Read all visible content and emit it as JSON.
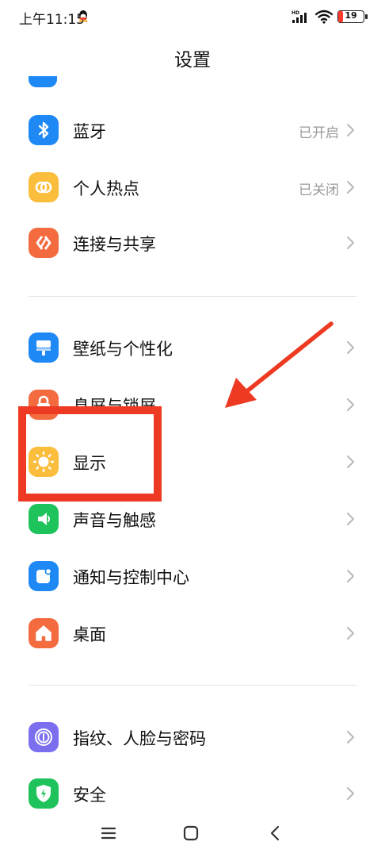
{
  "status_bar": {
    "time": "上午11:15",
    "battery": "19"
  },
  "header": {
    "title": "设置"
  },
  "sections": [
    {
      "rows": [
        {
          "label": "蓝牙",
          "value": "已开启",
          "icon": "bluetooth-icon",
          "icon_color": "#1e88f5"
        },
        {
          "label": "个人热点",
          "value": "已关闭",
          "icon": "hotspot-icon",
          "icon_color": "#fbbd3c"
        },
        {
          "label": "连接与共享",
          "value": "",
          "icon": "connection-sharing-icon",
          "icon_color": "#f36b3f"
        }
      ]
    },
    {
      "rows": [
        {
          "label": "壁纸与个性化",
          "value": "",
          "icon": "wallpaper-icon",
          "icon_color": "#1e88f5"
        },
        {
          "label": "息屏与锁屏",
          "value": "",
          "icon": "lock-screen-icon",
          "icon_color": "#f36b3f"
        },
        {
          "label": "显示",
          "value": "",
          "icon": "display-icon",
          "icon_color": "#fbbd3c"
        },
        {
          "label": "声音与触感",
          "value": "",
          "icon": "sound-icon",
          "icon_color": "#1fc35b"
        },
        {
          "label": "通知与控制中心",
          "value": "",
          "icon": "notification-icon",
          "icon_color": "#1e88f5"
        },
        {
          "label": "桌面",
          "value": "",
          "icon": "home-screen-icon",
          "icon_color": "#f36b3f"
        }
      ]
    },
    {
      "rows": [
        {
          "label": "指纹、人脸与密码",
          "value": "",
          "icon": "fingerprint-icon",
          "icon_color": "#7b6ff0"
        },
        {
          "label": "安全",
          "value": "",
          "icon": "security-shield-icon",
          "icon_color": "#1fc35b"
        }
      ]
    }
  ],
  "nav_bar": {
    "buttons": [
      "menu-icon",
      "home-icon",
      "back-icon"
    ]
  },
  "annotation": {
    "highlight_color": "#ee3a22"
  }
}
